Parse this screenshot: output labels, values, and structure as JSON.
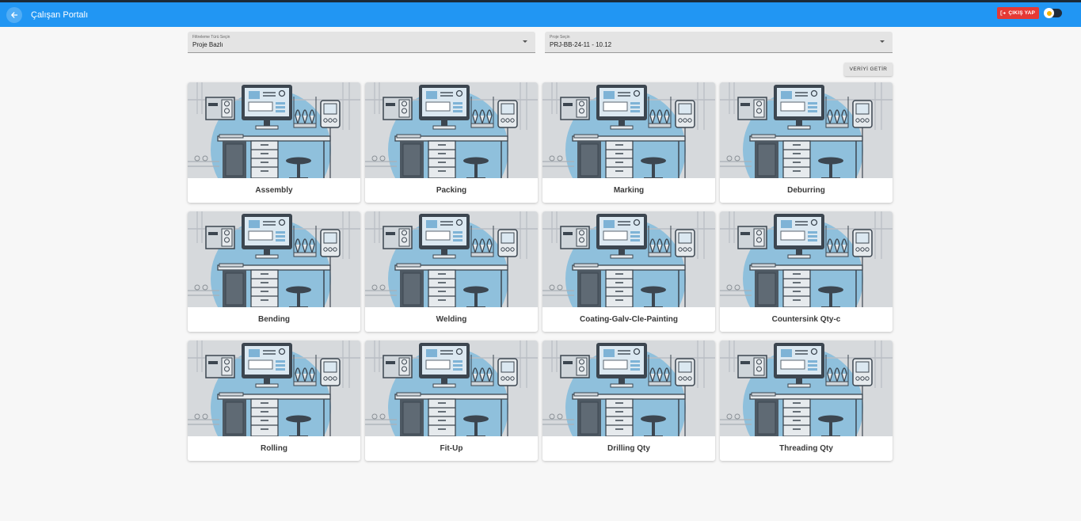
{
  "header": {
    "title": "Çalışan Portalı",
    "logout_label": "ÇIKIŞ YAP"
  },
  "filters": {
    "filter_type": {
      "label": "Filtreleme Türü Seçin",
      "value": "Proje Bazlı"
    },
    "project": {
      "label": "Proje Seçin",
      "value": "PRJ-BB-24-11 - 10.12"
    }
  },
  "fetch_label": "VERİYİ GETİR",
  "cards": [
    {
      "name": "Assembly"
    },
    {
      "name": "Packing"
    },
    {
      "name": "Marking"
    },
    {
      "name": "Deburring"
    },
    {
      "name": "Bending"
    },
    {
      "name": "Welding"
    },
    {
      "name": "Coating-Galv-Cle-Painting"
    },
    {
      "name": "Countersink Qty-c"
    },
    {
      "name": "Rolling"
    },
    {
      "name": "Fit-Up"
    },
    {
      "name": "Drilling Qty"
    },
    {
      "name": "Threading Qty"
    }
  ],
  "colors": {
    "appbar": "#2196f3",
    "logout": "#e53935",
    "illustration_bg": "#d6d9dc",
    "illustration_accent": "#8fc0dc"
  },
  "icons": {
    "back": "arrow-left-icon",
    "logout": "logout-icon",
    "theme": "sun-icon",
    "dropdown": "caret-down-icon"
  }
}
